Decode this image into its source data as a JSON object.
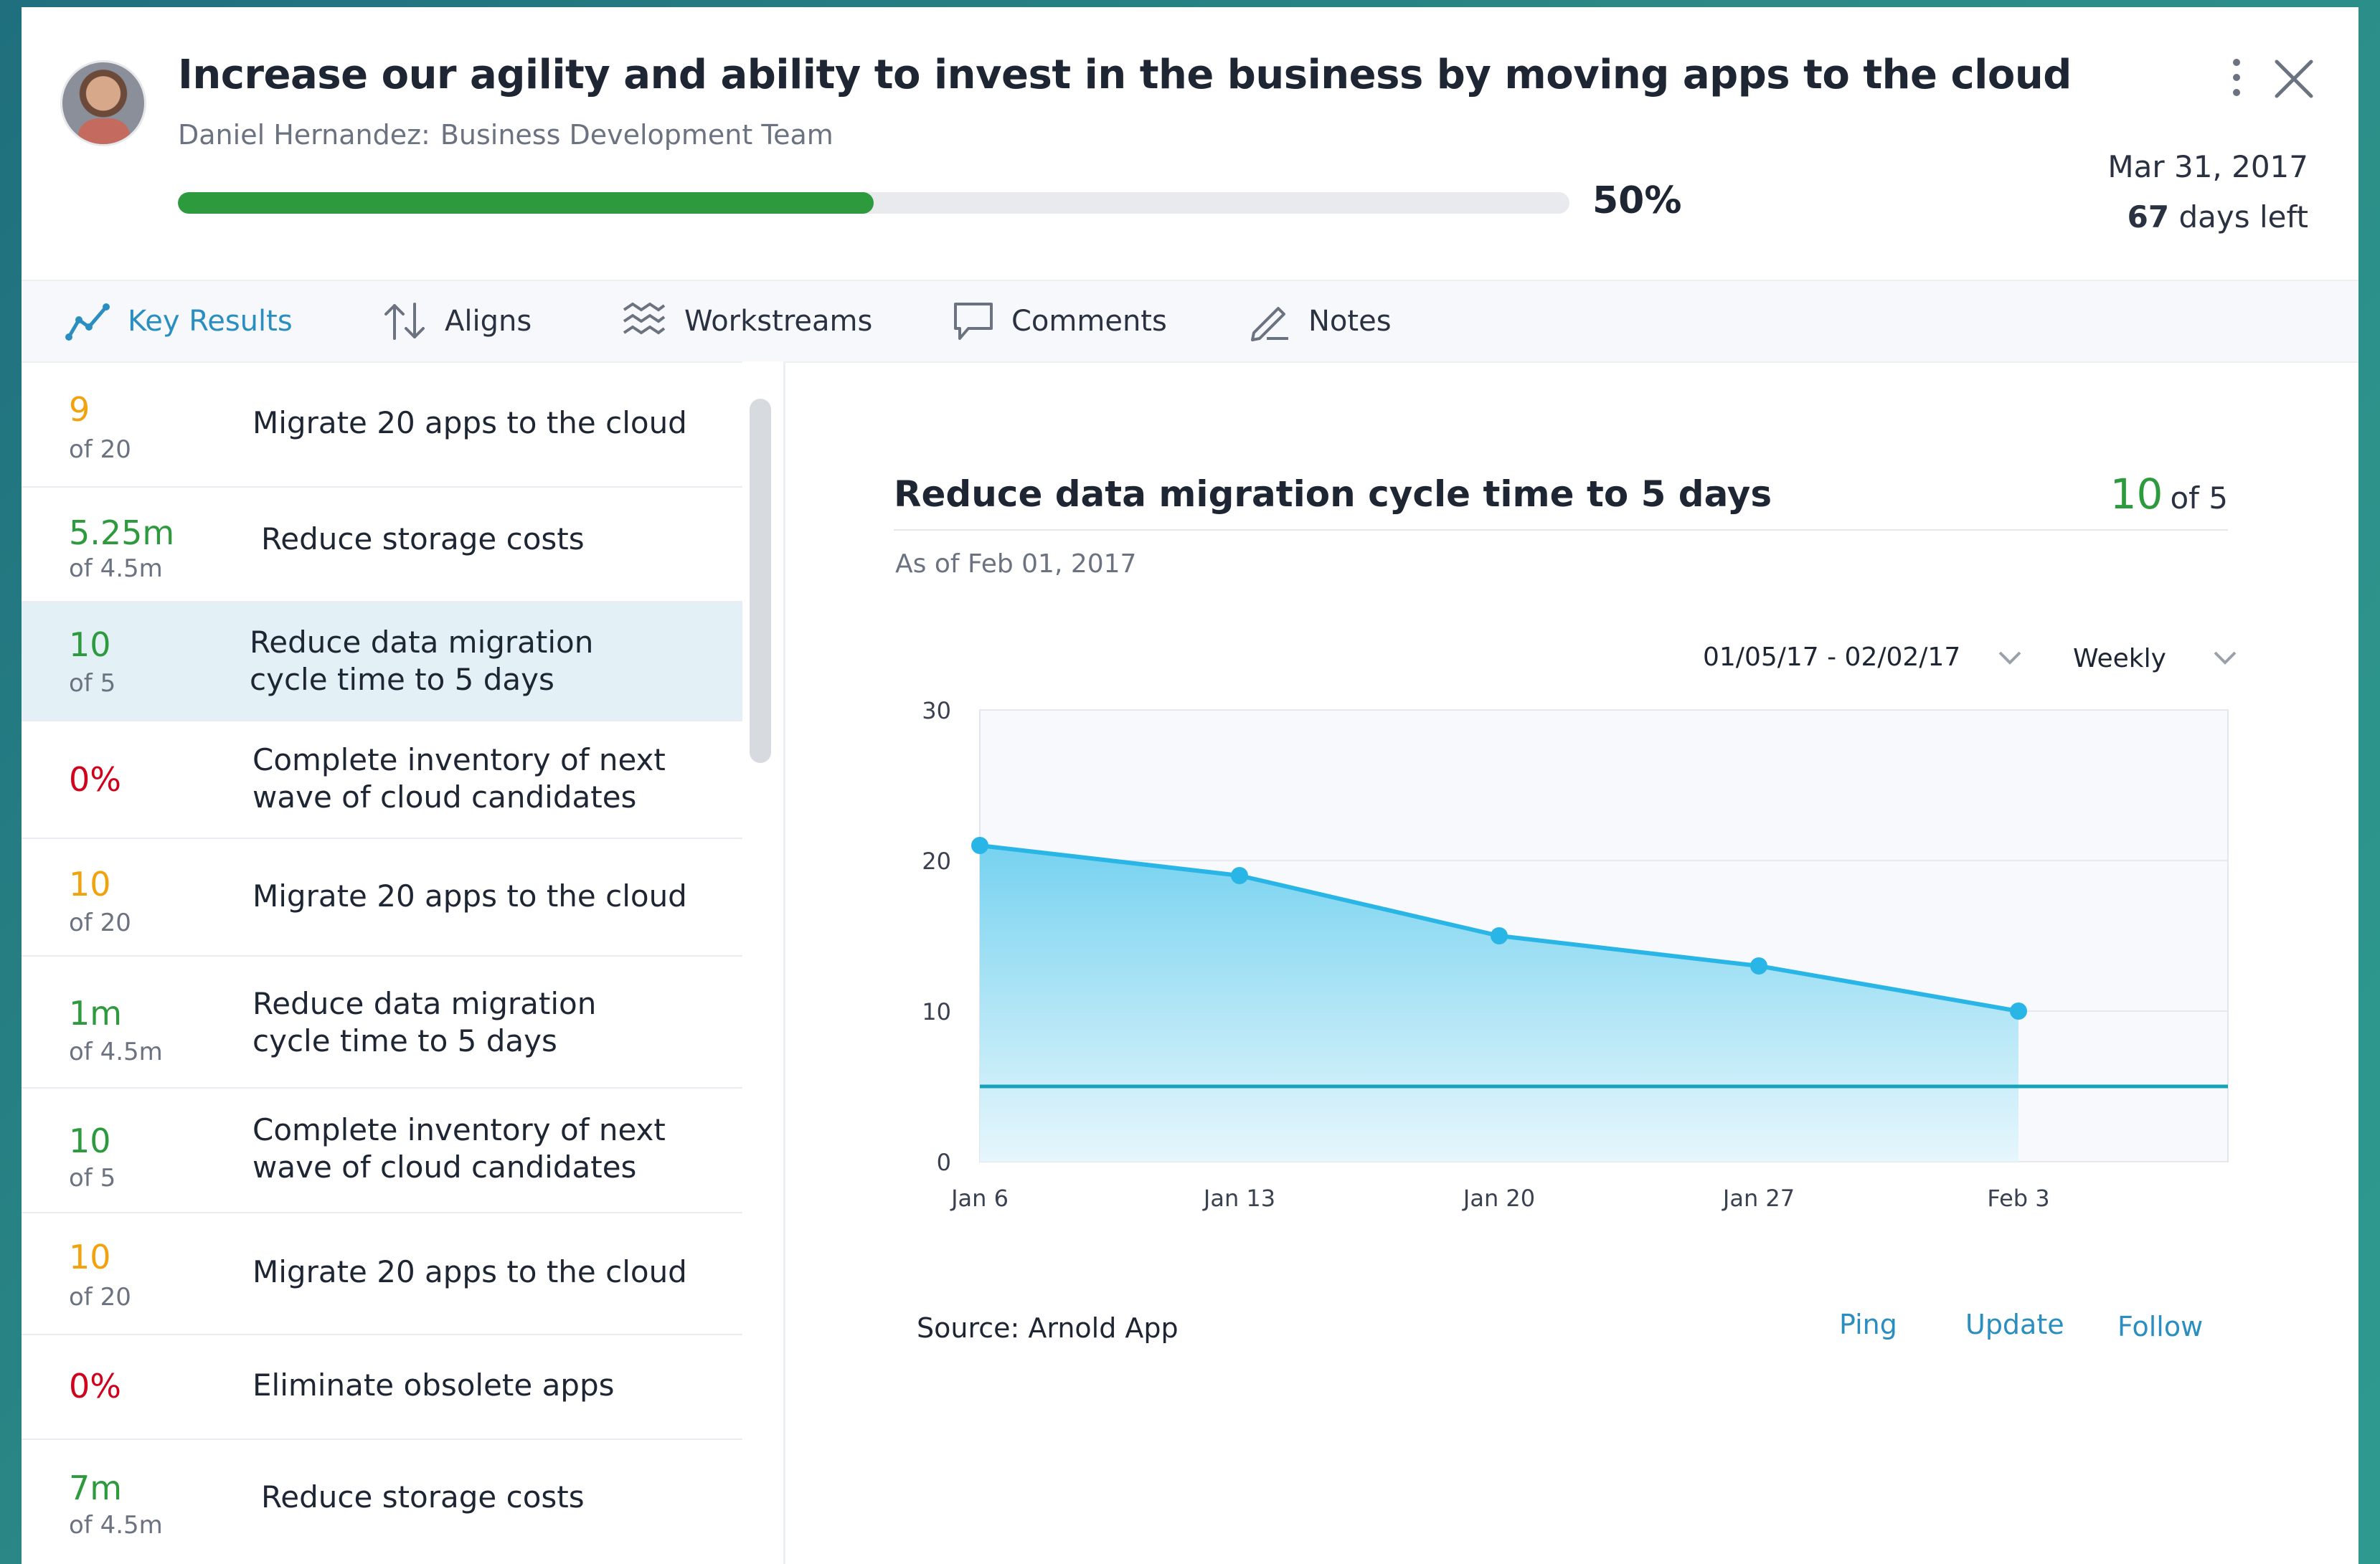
{
  "objective": {
    "title": "Increase our agility and ability to invest in the business by moving apps to the cloud",
    "owner": "Daniel Hernandez:",
    "team": "Business Development Team",
    "progress_pct": 50,
    "progress_label": "50%",
    "due_date": "Mar 31, 2017",
    "days_left_num": "67",
    "days_left_text": "days left"
  },
  "tabs": [
    {
      "label": "Key Results",
      "icon": "trend-line-icon",
      "active": true
    },
    {
      "label": "Aligns",
      "icon": "arrows-up-down-icon",
      "active": false
    },
    {
      "label": "Workstreams",
      "icon": "wavy-lines-icon",
      "active": false
    },
    {
      "label": "Comments",
      "icon": "speech-bubble-icon",
      "active": false
    },
    {
      "label": "Notes",
      "icon": "pen-icon",
      "active": false
    }
  ],
  "key_results": [
    {
      "value": "9",
      "of": "of 20",
      "label": "Migrate 20 apps to the cloud",
      "color": "#f2a20c"
    },
    {
      "value": "5.25m",
      "of": "of 4.5m",
      "label": "Reduce storage costs",
      "color": "#2e9a3e"
    },
    {
      "value": "10",
      "of": "of 5",
      "label": "Reduce data migration cycle time to 5 days",
      "color": "#2e9a3e",
      "selected": true
    },
    {
      "value": "0%",
      "of": "",
      "label": "Complete inventory of next wave of cloud candidates",
      "color": "#d0021b"
    },
    {
      "value": "10",
      "of": "of 20",
      "label": "Migrate 20 apps to the cloud",
      "color": "#f2a20c"
    },
    {
      "value": "1m",
      "of": "of 4.5m",
      "label": "Reduce data migration cycle time to 5 days",
      "color": "#2e9a3e"
    },
    {
      "value": "10",
      "of": "of 5",
      "label": "Complete inventory of next wave of cloud candidates",
      "color": "#2e9a3e"
    },
    {
      "value": "10",
      "of": "of 20",
      "label": "Migrate 20 apps to the cloud",
      "color": "#f2a20c"
    },
    {
      "value": "0%",
      "of": "",
      "label": "Eliminate obsolete apps",
      "color": "#d0021b"
    },
    {
      "value": "7m",
      "of": "of 4.5m",
      "label": "Reduce storage costs",
      "color": "#2e9a3e"
    }
  ],
  "detail": {
    "title": "Reduce data migration cycle time to 5 days",
    "score_value": "10",
    "score_of": "of 5",
    "as_of": "As of Feb 01, 2017",
    "date_range": "01/05/17 - 02/02/17",
    "frequency": "Weekly",
    "source": "Source: Arnold App",
    "actions": {
      "ping": "Ping",
      "update": "Update",
      "follow": "Follow"
    }
  },
  "chart_data": {
    "type": "area",
    "x": [
      "Jan 6",
      "Jan 13",
      "Jan 20",
      "Jan 27",
      "Feb 3"
    ],
    "series": [
      {
        "values": [
          21,
          19,
          15,
          13,
          10
        ]
      }
    ],
    "target": 5,
    "ylim": [
      0,
      30
    ],
    "yticks": [
      0,
      10,
      20,
      30
    ],
    "grid": true,
    "colors": {
      "line": "#29b6e6",
      "target": "#17a2b8"
    }
  }
}
